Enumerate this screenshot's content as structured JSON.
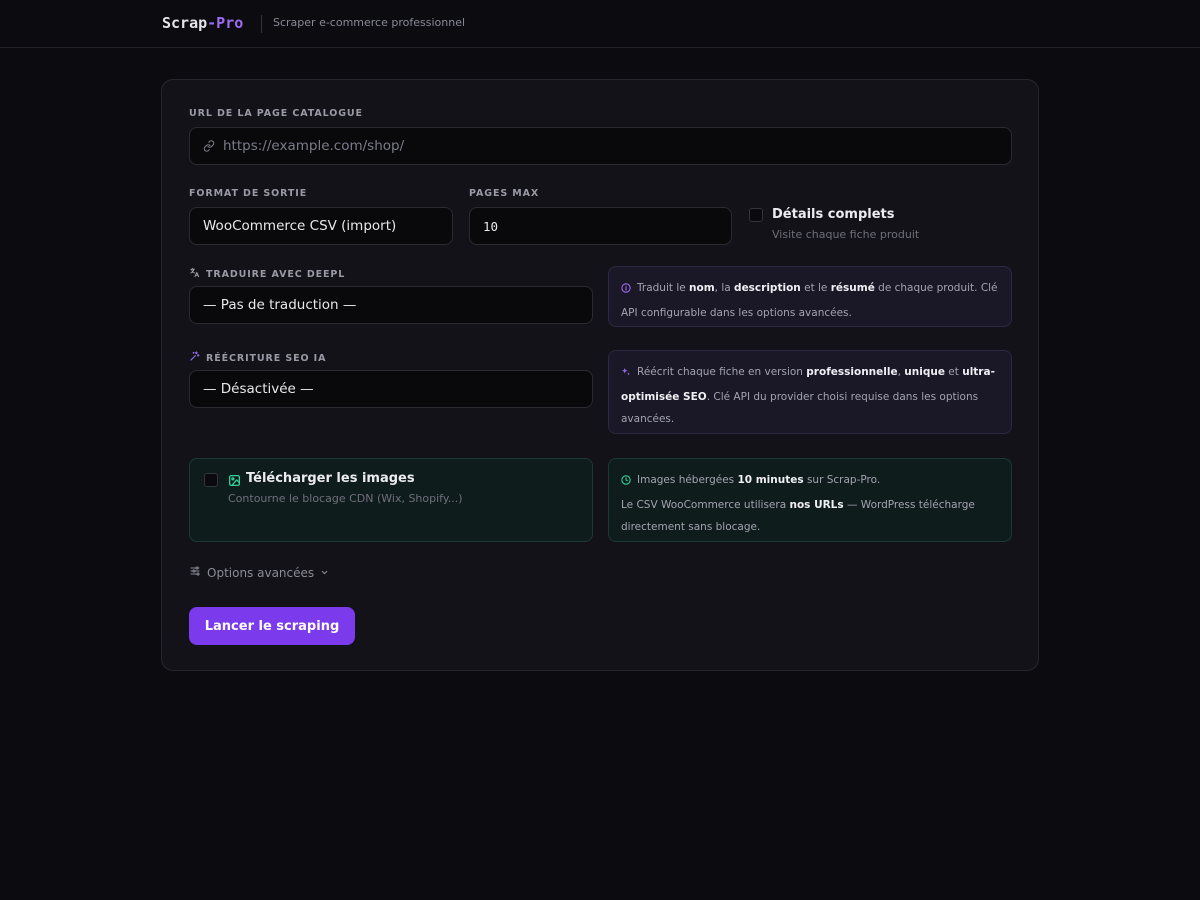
{
  "header": {
    "brand_main": "Scrap",
    "brand_accent": "-Pro",
    "tagline": "Scraper e-commerce professionnel"
  },
  "form": {
    "url": {
      "label": "URL DE LA PAGE CATALOGUE",
      "placeholder": "https://example.com/shop/",
      "icon": "link-icon"
    },
    "format": {
      "label": "FORMAT DE SORTIE",
      "value": "WooCommerce CSV (import)"
    },
    "pages": {
      "label": "PAGES MAX",
      "value": "10"
    },
    "details": {
      "title": "Détails complets",
      "subtitle": "Visite chaque fiche produit",
      "checked": false
    },
    "translate": {
      "label": "TRADUIRE AVEC DEEPL",
      "icon": "translate-icon",
      "value": "— Pas de traduction —",
      "info": {
        "icon": "info-icon",
        "t1": "Traduit le ",
        "b1": "nom",
        "t2": ", la ",
        "b2": "description",
        "t3": " et le ",
        "b3": "résumé",
        "t4": " de chaque produit. Clé API configurable dans les options avancées."
      }
    },
    "seo": {
      "label": "RÉÉCRITURE SEO IA",
      "icon": "magic-wand-icon",
      "value": "— Désactivée —",
      "info": {
        "icon": "sparkles-icon",
        "t1": "Réécrit chaque fiche en version ",
        "b1": "professionnelle",
        "t2": ", ",
        "b2": "unique",
        "t3": " et ",
        "b3": "ultra-optimisée SEO",
        "t4": ". Clé API du provider choisi requise dans les options avancées."
      }
    },
    "images": {
      "title": "Télécharger les images",
      "subtitle": "Contourne le blocage CDN (Wix, Shopify...)",
      "icon": "image-icon",
      "checked": false,
      "info": {
        "icon": "clock-icon",
        "t1": "Images hébergées ",
        "b1": "10 minutes",
        "t2": " sur Scrap-Pro.",
        "t3": "Le CSV WooCommerce utilisera ",
        "b2": "nos URLs",
        "t4": " — WordPress télécharge directement sans blocage."
      }
    },
    "advanced": {
      "label": "Options avancées",
      "icon": "sliders-icon"
    },
    "submit": {
      "label": "Lancer le scraping"
    }
  },
  "colors": {
    "accent": "#7c3aed",
    "background": "#0b0b10",
    "card": "#121218"
  }
}
